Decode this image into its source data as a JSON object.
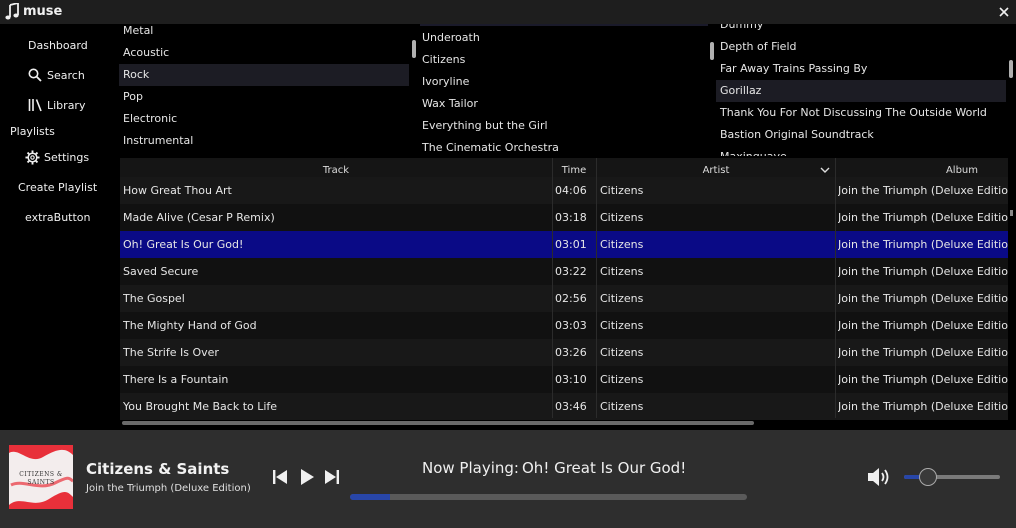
{
  "window": {
    "title": "muse"
  },
  "sidebar": {
    "dashboard": "Dashboard",
    "search": "Search",
    "library": "Library",
    "playlists_heading": "Playlists",
    "settings": "Settings",
    "create_playlist": "Create Playlist",
    "extra": "extraButton"
  },
  "genres": [
    "Metal",
    "Acoustic",
    "Rock",
    "Pop",
    "Electronic",
    "Instrumental"
  ],
  "genres_selected": "Rock",
  "artists": [
    "Underoath",
    "Citizens",
    "Ivoryline",
    "Wax Tailor",
    "Everything but the Girl",
    "The Cinematic Orchestra"
  ],
  "albums": [
    "Dummy",
    "Depth of Field",
    "Far Away Trains Passing By",
    "Gorillaz",
    "Thank You For Not Discussing The Outside World",
    "Bastion Original Soundtrack",
    "Maxinquaye"
  ],
  "albums_selected": "Gorillaz",
  "tracks": {
    "headers": {
      "track": "Track",
      "time": "Time",
      "artist": "Artist",
      "album": "Album"
    },
    "rows": [
      {
        "track": "How Great Thou Art",
        "time": "04:06",
        "artist": "Citizens",
        "album": "Join the Triumph (Deluxe Edition)"
      },
      {
        "track": "Made Alive (Cesar P Remix)",
        "time": "03:18",
        "artist": "Citizens",
        "album": "Join the Triumph (Deluxe Edition)"
      },
      {
        "track": "Oh! Great Is Our God!",
        "time": "03:01",
        "artist": "Citizens",
        "album": "Join the Triumph (Deluxe Edition)"
      },
      {
        "track": "Saved Secure",
        "time": "03:22",
        "artist": "Citizens",
        "album": "Join the Triumph (Deluxe Edition)"
      },
      {
        "track": "The Gospel",
        "time": "02:56",
        "artist": "Citizens",
        "album": "Join the Triumph (Deluxe Edition)"
      },
      {
        "track": "The Mighty Hand of God",
        "time": "03:03",
        "artist": "Citizens",
        "album": "Join the Triumph (Deluxe Edition)"
      },
      {
        "track": "The Strife Is Over",
        "time": "03:26",
        "artist": "Citizens",
        "album": "Join the Triumph (Deluxe Edition)"
      },
      {
        "track": "There Is a Fountain",
        "time": "03:10",
        "artist": "Citizens",
        "album": "Join the Triumph (Deluxe Edition)"
      },
      {
        "track": "You Brought Me Back to Life",
        "time": "03:46",
        "artist": "Citizens",
        "album": "Join the Triumph (Deluxe Edition)"
      }
    ],
    "selected": "Oh! Great Is Our God!"
  },
  "player": {
    "cover_text": "CITIZENS & SAINTS",
    "title": "Citizens & Saints",
    "album": "Join the Triumph (Deluxe Edition)",
    "now_playing_label": "Now Playing:",
    "now_playing_track": "Oh! Great Is Our God!",
    "progress": 0.1,
    "volume": 0.25
  },
  "colors": {
    "selection": "#0a0a86",
    "accent": "#2846a8",
    "background": "#000000",
    "player_bg": "#2e2e2e"
  },
  "icons": [
    "music-note-icon",
    "close-icon",
    "search-icon",
    "library-icon",
    "gear-icon",
    "previous-icon",
    "play-icon",
    "next-icon",
    "volume-icon",
    "sort-chevron-icon"
  ]
}
